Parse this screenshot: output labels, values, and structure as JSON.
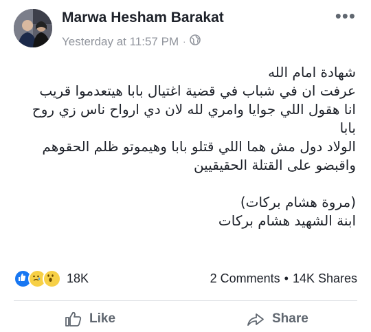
{
  "post": {
    "author": "Marwa Hesham Barakat",
    "timestamp": "Yesterday at 11:57 PM",
    "separator": "·",
    "privacy_icon": "globe-icon",
    "more_label": "•••",
    "body_lines": [
      "شهادة امام الله",
      "عرفت ان في شباب في قضية اغتيال بابا هيتعدموا قريب",
      "انا هقول اللي جوايا وامري لله لان دي ارواح ناس زي روح",
      "بابا",
      "الولاد دول مش هما اللي قتلو بابا وهيموتو ظلم الحقوهم",
      "واقبضو على القتلة الحقيقيين",
      "",
      "(مروة هشام بركات)",
      "ابنة الشهيد هشام بركات"
    ]
  },
  "stats": {
    "reaction_icons": [
      "like-reaction-icon",
      "sad-reaction-icon",
      "wow-reaction-icon"
    ],
    "reaction_count": "18K",
    "comments": "2 Comments",
    "dot": "•",
    "shares": "14K Shares"
  },
  "actions": {
    "like_label": "Like",
    "share_label": "Share"
  },
  "colors": {
    "text": "#1d2129",
    "meta": "#90949c",
    "like_blue": "#1877f2",
    "emoji_yellow": "#f7d046",
    "action_gray": "#606770"
  }
}
